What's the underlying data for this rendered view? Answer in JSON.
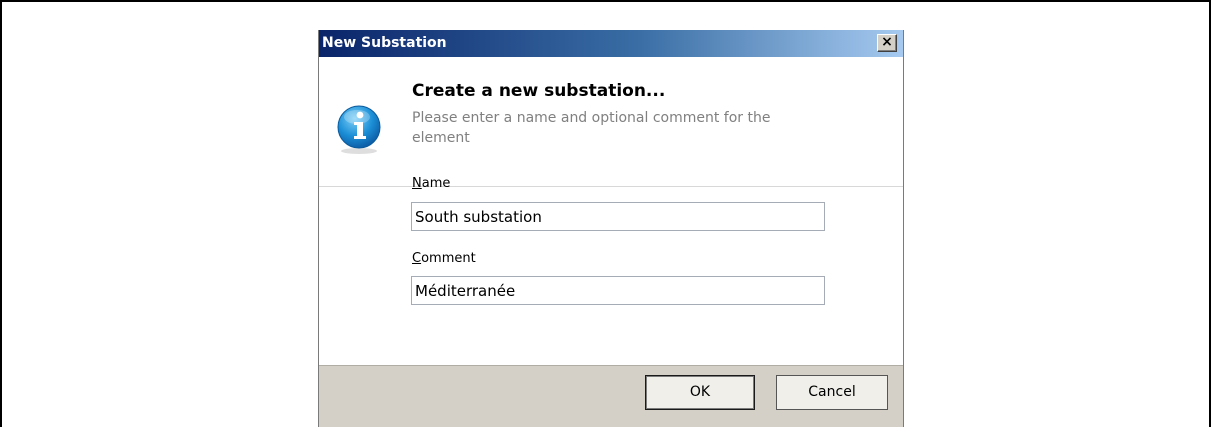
{
  "window": {
    "title": "New Substation",
    "close_label": "×"
  },
  "header": {
    "heading": "Create a new substation...",
    "subtext": "Please enter a name and optional comment for the element"
  },
  "form": {
    "name_label_accel": "N",
    "name_label_rest": "ame",
    "name_value": "South substation",
    "comment_label_accel": "C",
    "comment_label_rest": "omment",
    "comment_value": "Méditerranée"
  },
  "buttons": {
    "ok_label": "OK",
    "cancel_label": "Cancel"
  },
  "colors": {
    "titlebar_start": "#0a246a",
    "titlebar_end": "#a6caf0",
    "footer_bg": "#d4d0c8",
    "subtext": "#808080"
  },
  "icons": {
    "info": "info-icon",
    "close": "close-icon"
  }
}
